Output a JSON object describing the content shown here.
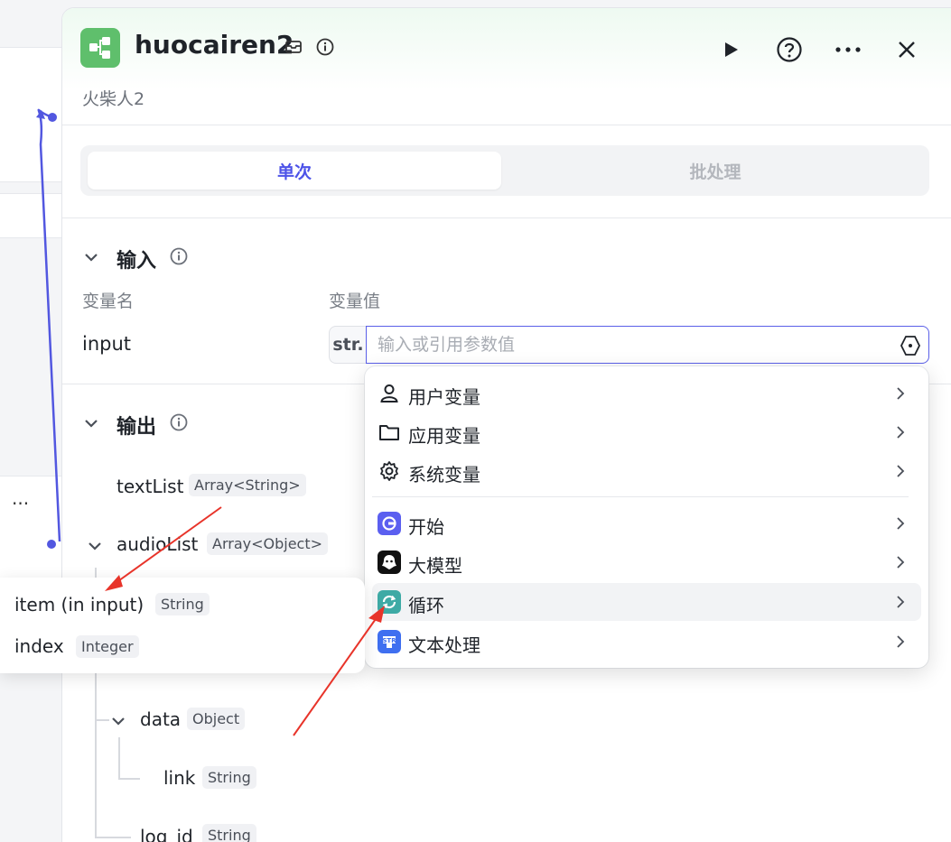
{
  "panel": {
    "title": "huocairen2",
    "subtitle": "火柴人2",
    "tabs": [
      {
        "label": "单次",
        "active": true
      },
      {
        "label": "批处理",
        "active": false
      }
    ]
  },
  "input_section": {
    "title": "输入",
    "col_name": "变量名",
    "col_value": "变量值",
    "row": {
      "name": "input",
      "type": "str.",
      "placeholder": "输入或引用参数值"
    }
  },
  "output_section": {
    "title": "输出",
    "fields": [
      {
        "name": "textList",
        "type": "Array<String>"
      },
      {
        "name": "audioList",
        "type": "Array<Object>"
      },
      {
        "name": "data",
        "type": "Object"
      },
      {
        "name": "link",
        "type": "String"
      },
      {
        "name": "log_id",
        "type": "String"
      }
    ]
  },
  "dropdown": {
    "items": [
      {
        "label": "用户变量",
        "icon": "user-icon"
      },
      {
        "label": "应用变量",
        "icon": "folder-icon"
      },
      {
        "label": "系统变量",
        "icon": "gear-icon"
      },
      {
        "label": "开始",
        "icon": "start-node-icon",
        "color": "#5b5ff0"
      },
      {
        "label": "大模型",
        "icon": "llm-node-icon",
        "color": "#111111"
      },
      {
        "label": "循环",
        "icon": "loop-node-icon",
        "color": "#3eaaa5"
      },
      {
        "label": "文本处理",
        "icon": "text-process-node-icon",
        "color": "#3f6ff0"
      }
    ]
  },
  "loop_popup": {
    "items": [
      {
        "name": "item (in input)",
        "type": "String"
      },
      {
        "name": "index",
        "type": "Integer"
      }
    ]
  },
  "canvas": {
    "more_label": "···"
  },
  "colors": {
    "accent": "#4d53e8",
    "app_icon": "#5fbf6c",
    "annotation_arrow": "#e8342a",
    "connector": "#5257e0"
  }
}
